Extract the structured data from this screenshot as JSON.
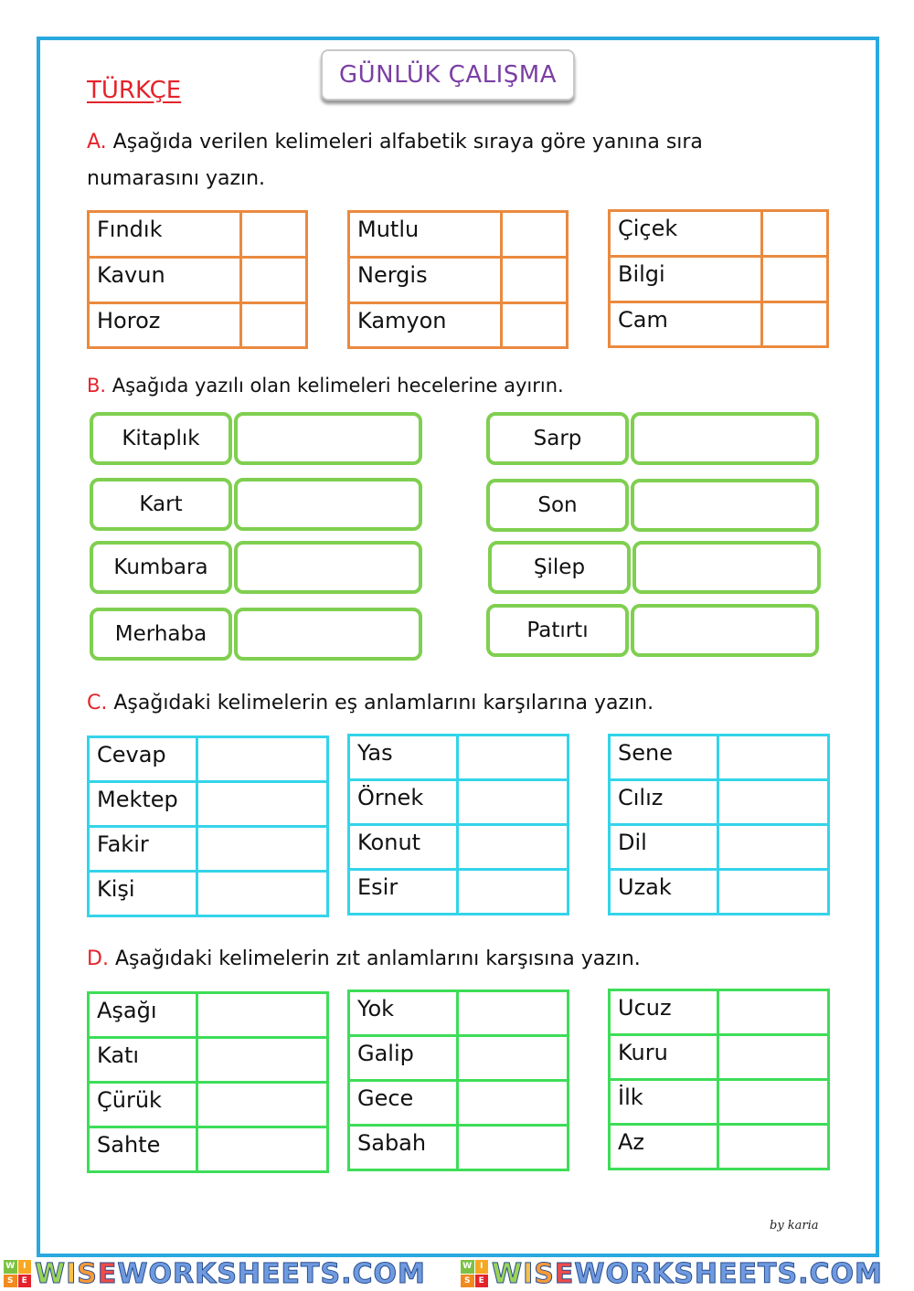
{
  "header": {
    "title": "GÜNLÜK ÇALIŞMA",
    "subject": "TÜRKÇE"
  },
  "colors": {
    "frame": "#29a9e0",
    "title_text": "#7b3fa4",
    "accent_red": "#e4232b",
    "orange_table": "#ea8a3f",
    "green_box": "#7fcf50",
    "cyan_table": "#33d4ea",
    "green_table": "#3ddd57"
  },
  "section_a": {
    "letter": "A.",
    "instruction_line1": "Aşağıda verilen kelimeleri alfabetik sıraya göre yanına sıra",
    "instruction_line2": "numarasını yazın.",
    "tables": [
      {
        "words": [
          "Fındık",
          "Kavun",
          "Horoz"
        ]
      },
      {
        "words": [
          "Mutlu",
          "Nergis",
          "Kamyon"
        ]
      },
      {
        "words": [
          "Çiçek",
          "Bilgi",
          "Cam"
        ]
      }
    ]
  },
  "section_b": {
    "letter": "B.",
    "instruction": "Aşağıda yazılı olan kelimeleri hecelerine ayırın.",
    "left_words": [
      "Kitaplık",
      "Kart",
      "Kumbara",
      "Merhaba"
    ],
    "right_words": [
      "Sarp",
      "Son",
      "Şilep",
      "Patırtı"
    ]
  },
  "section_c": {
    "letter": "C.",
    "instruction": "Aşağıdaki kelimelerin eş anlamlarını karşılarına yazın.",
    "tables": [
      {
        "words": [
          "Cevap",
          "Mektep",
          "Fakir",
          "Kişi"
        ]
      },
      {
        "words": [
          "Yas",
          "Örnek",
          "Konut",
          "Esir"
        ]
      },
      {
        "words": [
          "Sene",
          "Cılız",
          "Dil",
          "Uzak"
        ]
      }
    ]
  },
  "section_d": {
    "letter": "D.",
    "instruction": "Aşağıdaki kelimelerin zıt anlamlarını karşısına yazın.",
    "tables": [
      {
        "words": [
          "Aşağı",
          "Katı",
          "Çürük",
          "Sahte"
        ]
      },
      {
        "words": [
          "Yok",
          "Galip",
          "Gece",
          "Sabah"
        ]
      },
      {
        "words": [
          "Ucuz",
          "Kuru",
          "İlk",
          "Az"
        ]
      }
    ]
  },
  "footer": {
    "credit": "by karia",
    "watermark": "WISEWORKSHEETS.COM",
    "logo_letters": [
      "W",
      "I",
      "S",
      "E"
    ]
  }
}
